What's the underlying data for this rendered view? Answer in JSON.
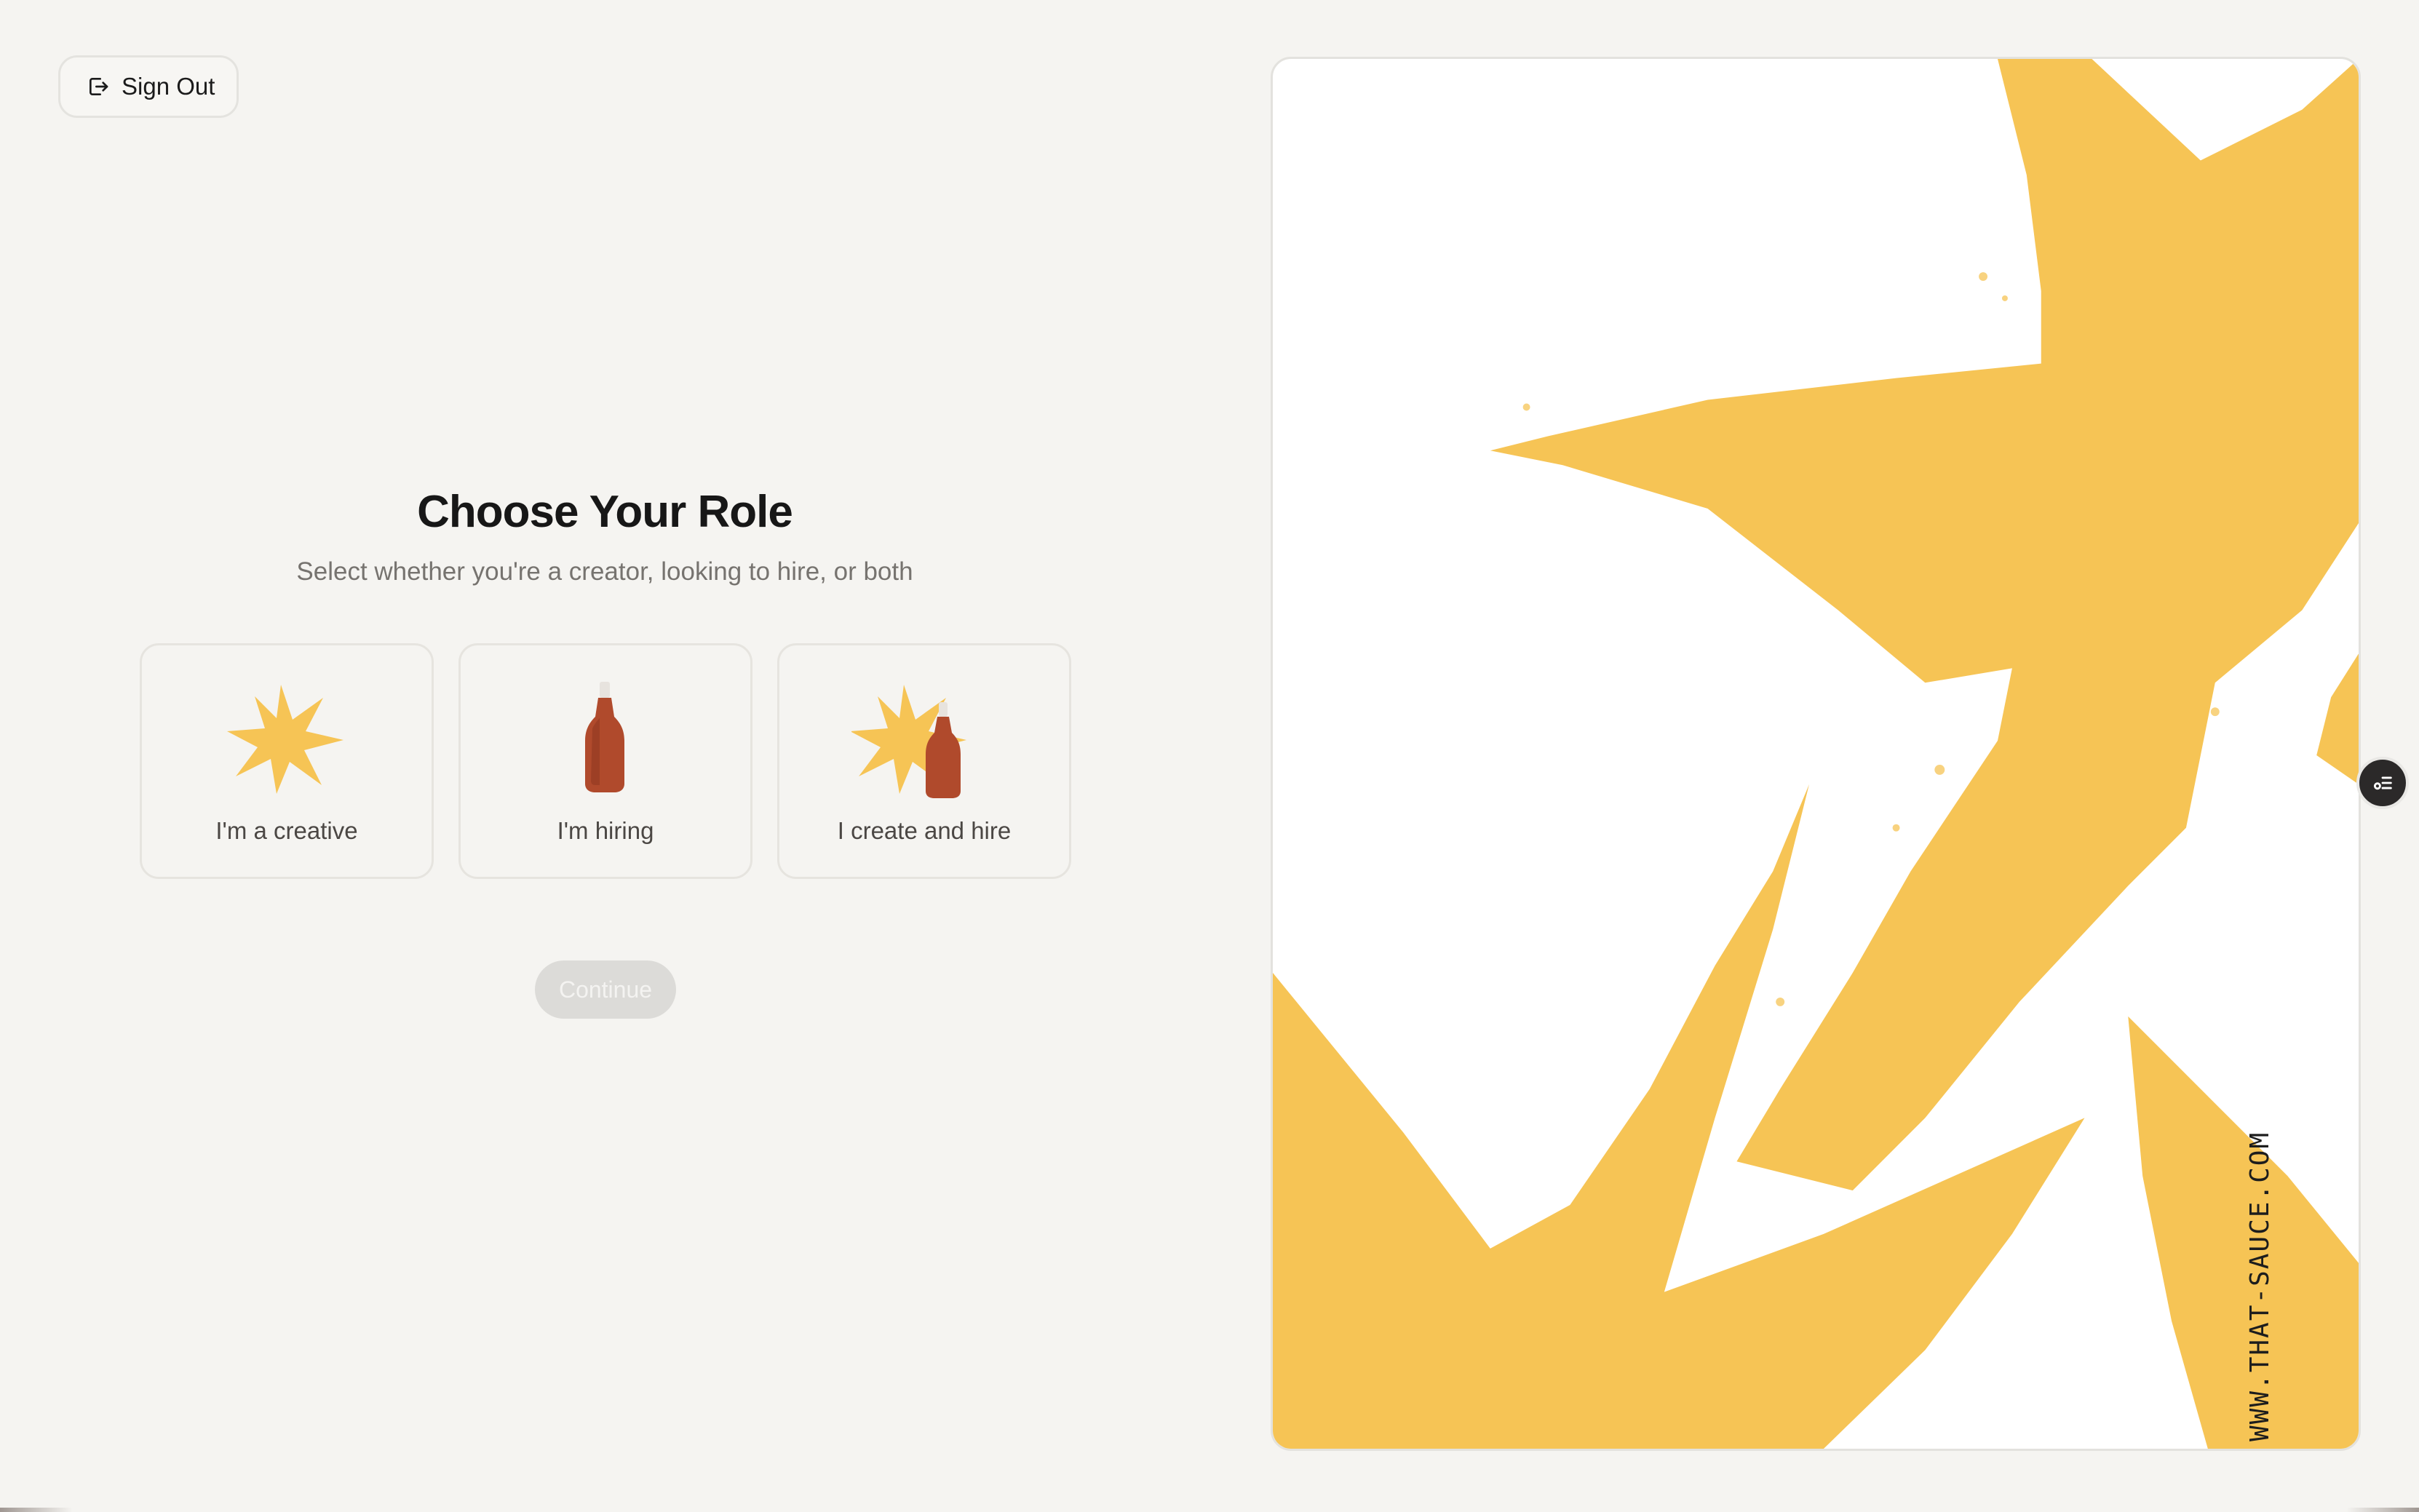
{
  "header": {
    "sign_out_label": "Sign Out"
  },
  "main": {
    "title": "Choose Your Role",
    "subtitle": "Select whether you're a creator, looking to hire, or both",
    "roles": [
      {
        "label": "I'm a creative",
        "icon": "star-burst-icon"
      },
      {
        "label": "I'm hiring",
        "icon": "sauce-bottle-icon"
      },
      {
        "label": "I create and hire",
        "icon": "star-and-bottle-icon"
      }
    ],
    "continue_label": "Continue"
  },
  "hero": {
    "url_text": "WWW.THAT-SAUCE.COM"
  },
  "colors": {
    "background": "#f5f4f1",
    "accent_yellow": "#f6c455",
    "bottle": "#b04a2c",
    "continue_disabled": "#dcdbd8"
  }
}
